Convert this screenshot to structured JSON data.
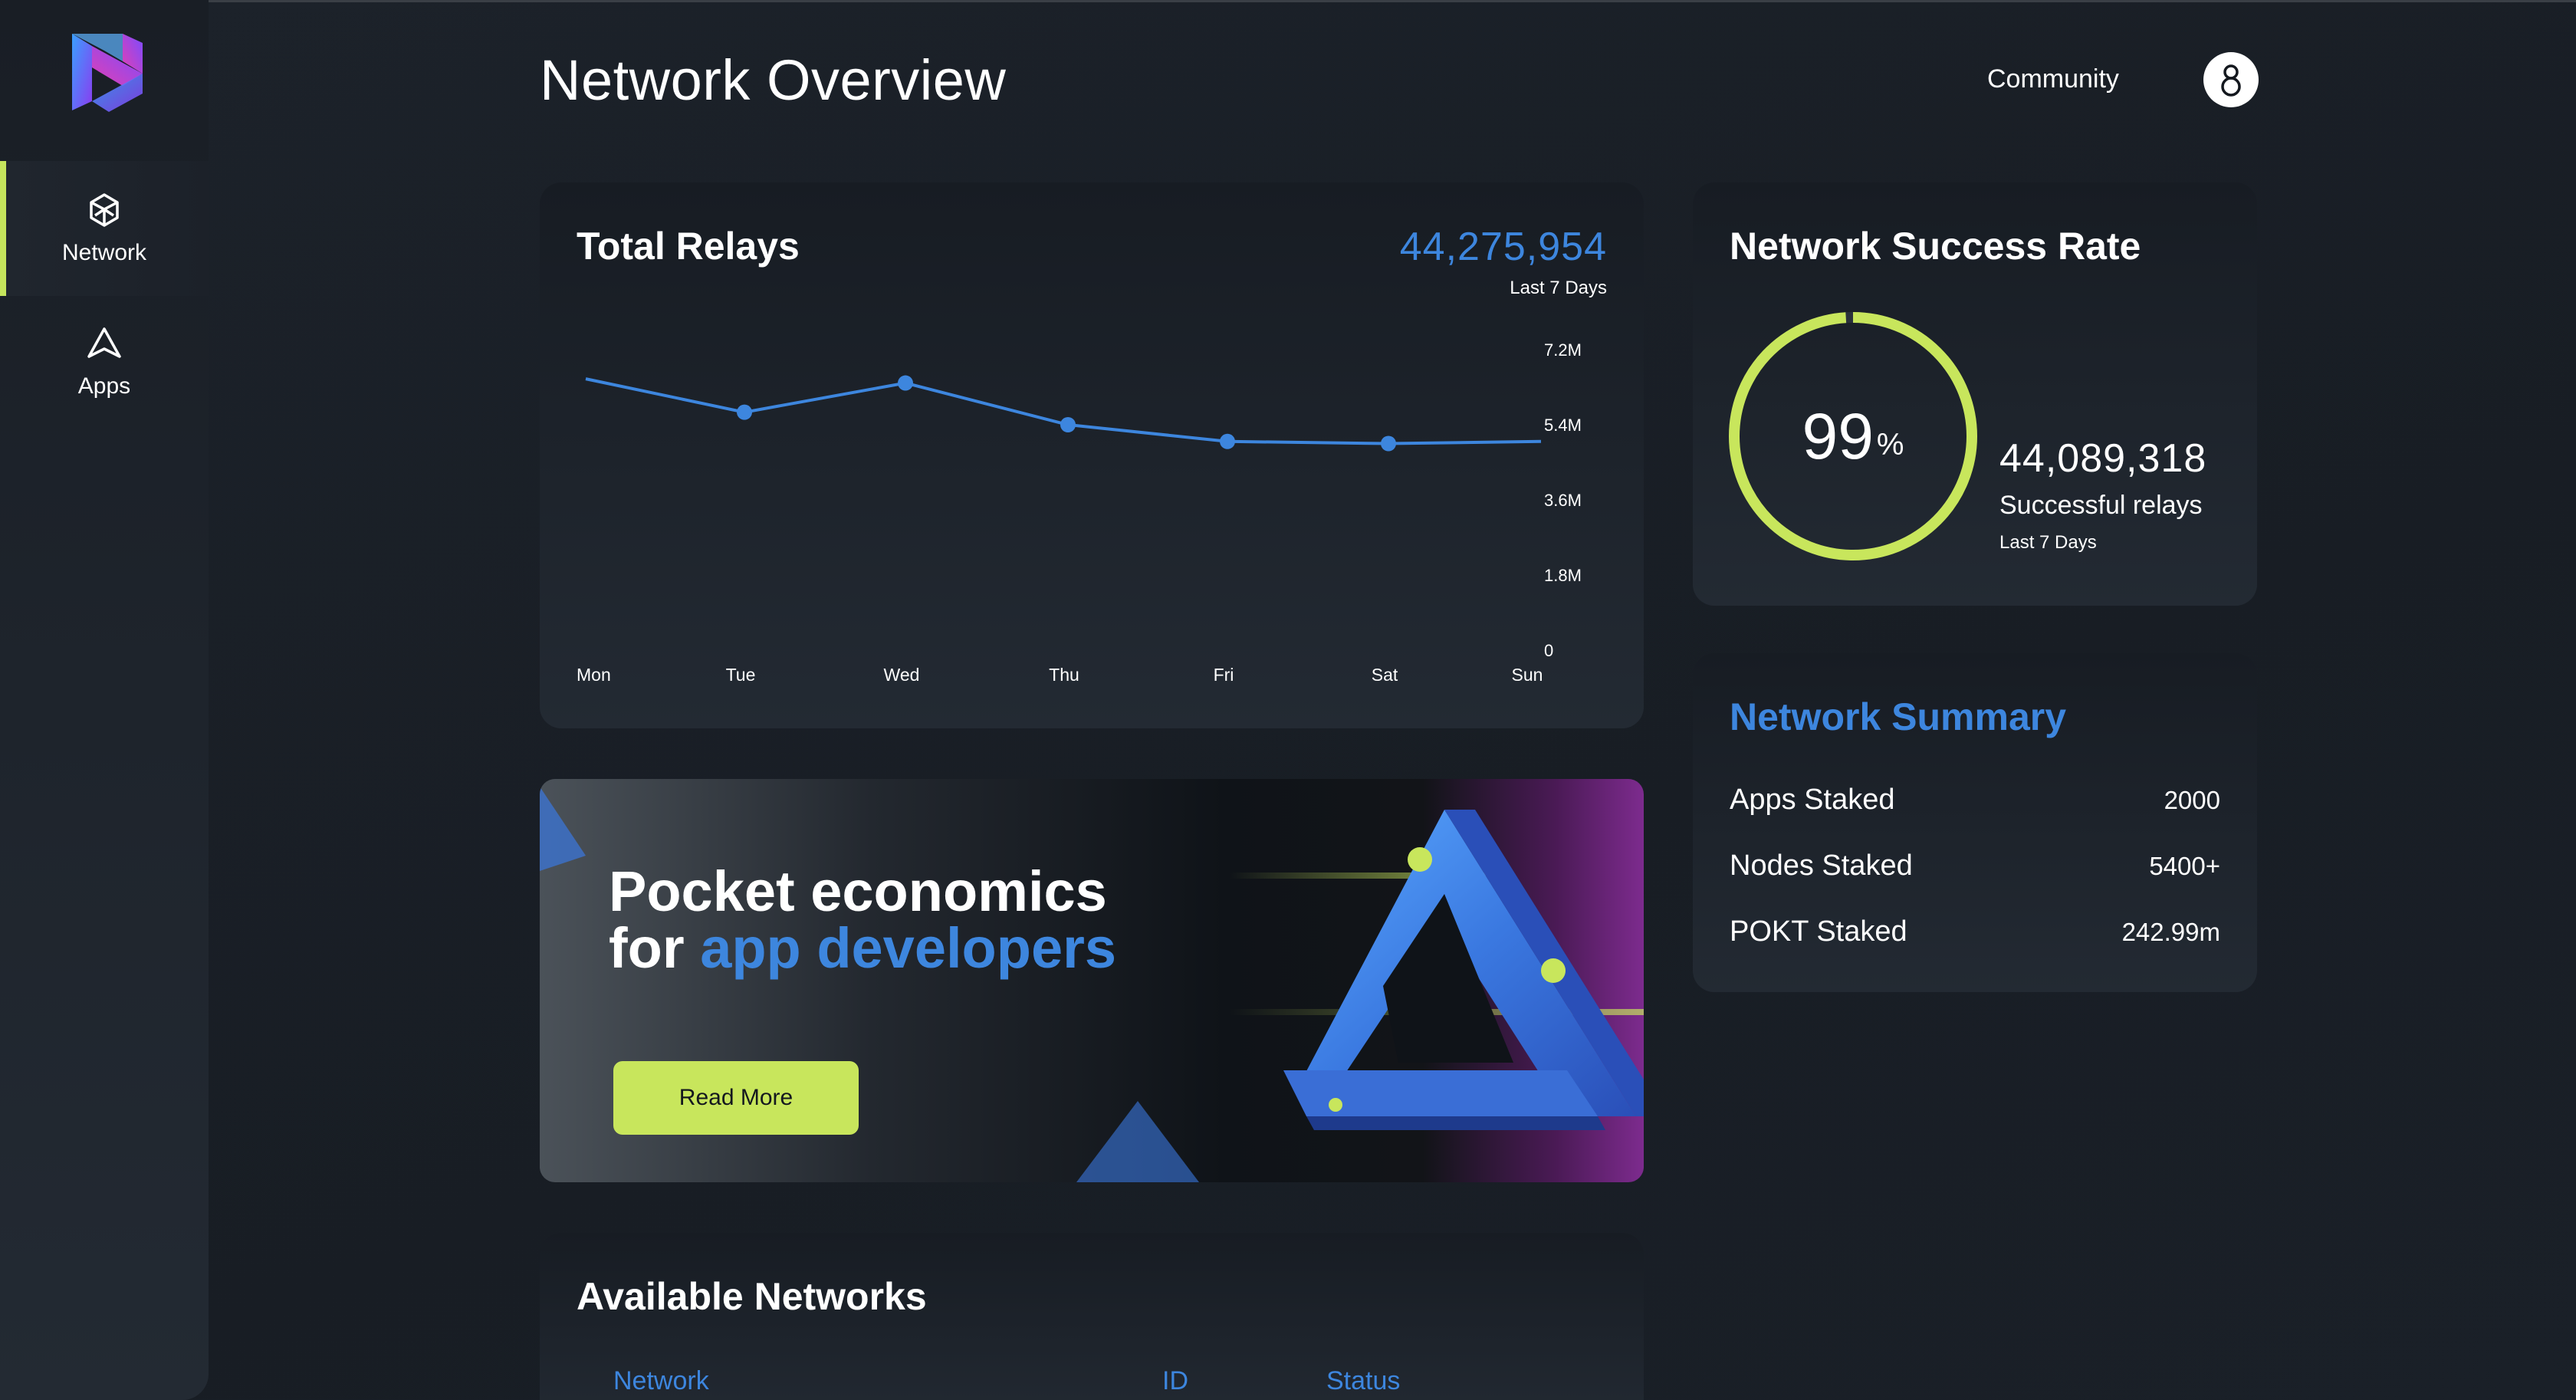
{
  "sidebar": {
    "items": [
      {
        "label": "Network",
        "icon": "network-hexagon-icon",
        "active": true
      },
      {
        "label": "Apps",
        "icon": "apps-triangle-icon",
        "active": false
      }
    ]
  },
  "header": {
    "title": "Network Overview",
    "community_label": "Community",
    "avatar_icon": "user-avatar-icon"
  },
  "relays": {
    "title": "Total Relays",
    "total": "44,275,954",
    "period": "Last 7 Days"
  },
  "chart_data": {
    "type": "line",
    "categories": [
      "Mon",
      "Tue",
      "Wed",
      "Thu",
      "Fri",
      "Sat",
      "Sun"
    ],
    "values": [
      6.5,
      5.7,
      6.4,
      5.4,
      5.0,
      4.95,
      5.0
    ],
    "y_ticks": [
      "7.2M",
      "5.4M",
      "3.6M",
      "1.8M",
      "0"
    ],
    "ylim": [
      0,
      7.2
    ],
    "unit": "M",
    "color": "#3d86de",
    "grid": false
  },
  "success": {
    "title": "Network Success Rate",
    "rate_value": "99",
    "rate_unit": "%",
    "rate_fraction": 0.99,
    "count": "44,089,318",
    "count_label": "Successful relays",
    "period": "Last 7 Days",
    "ring_color": "#c8e65c"
  },
  "summary": {
    "title": "Network Summary",
    "rows": [
      {
        "label": "Apps Staked",
        "value": "2000"
      },
      {
        "label": "Nodes Staked",
        "value": "5400+"
      },
      {
        "label": "POKT Staked",
        "value": "242.99m"
      }
    ]
  },
  "banner": {
    "title_line1": "Pocket economics",
    "title_line2_prefix": "for ",
    "title_line2_accent": "app developers",
    "button_label": "Read More"
  },
  "networks": {
    "title": "Available Networks",
    "columns": [
      "Network",
      "ID",
      "Status"
    ]
  },
  "colors": {
    "accent_blue": "#3d86de",
    "accent_green": "#c8e65c",
    "background": "#1a2028"
  }
}
